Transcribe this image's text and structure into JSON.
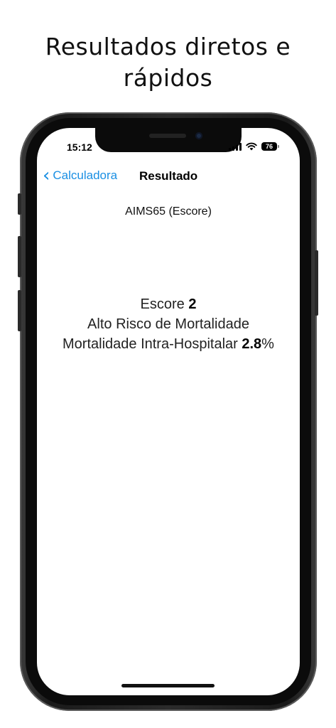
{
  "headline": {
    "line1": "Resultados diretos e",
    "line2": "rápidos"
  },
  "status_bar": {
    "time": "15:12",
    "battery_level": "76"
  },
  "nav": {
    "back_label": "Calculadora",
    "title": "Resultado"
  },
  "calculator_name": "AIMS65 (Escore)",
  "result": {
    "score_label": "Escore",
    "score_value": "2",
    "risk_text": "Alto Risco de Mortalidade",
    "mortality_label": "Mortalidade Intra-Hospitalar",
    "mortality_value": "2.8",
    "mortality_unit": "%"
  },
  "colors": {
    "accent": "#1a8fe3",
    "frame": "#1a1a1a"
  }
}
